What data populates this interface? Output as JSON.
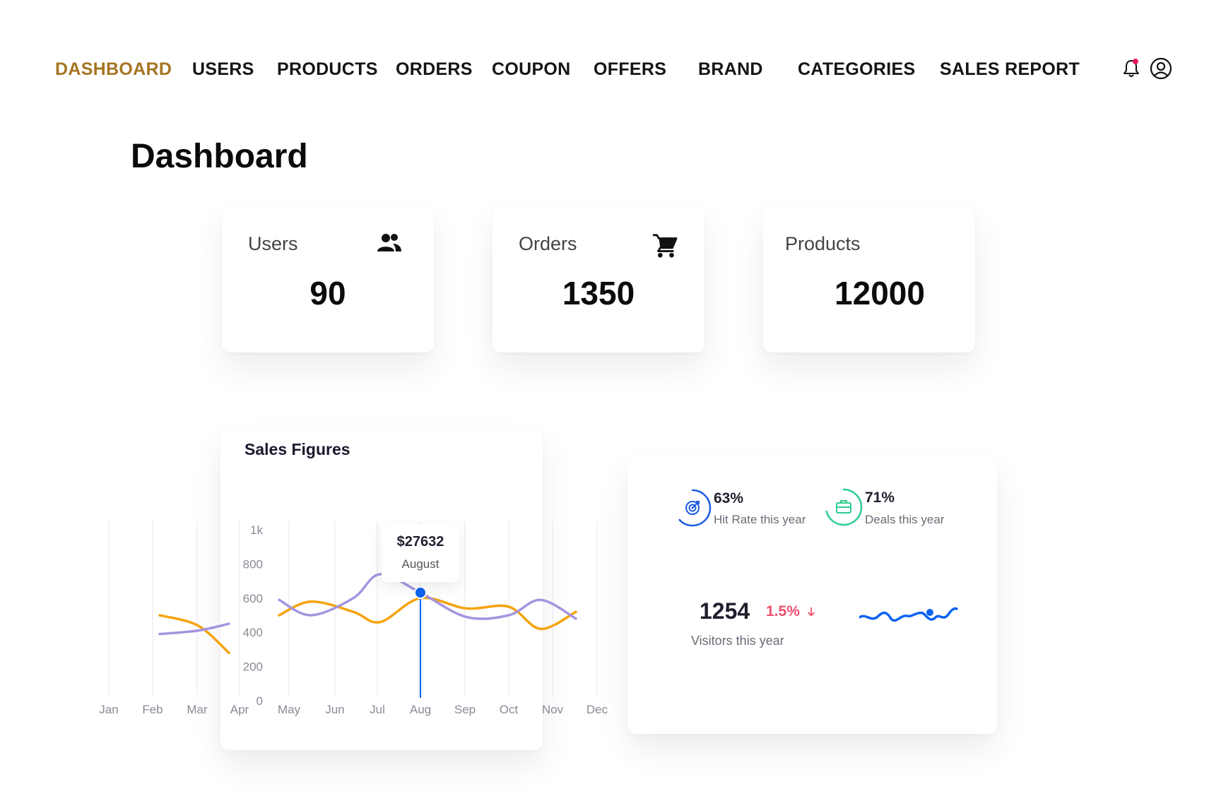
{
  "nav": {
    "items": [
      "DASHBOARD",
      "USERS",
      "PRODUCTS",
      "ORDERS",
      "COUPON",
      "OFFERS",
      "BRAND",
      "CATEGORIES",
      "SALES REPORT"
    ],
    "active": "DASHBOARD",
    "active_color": "#A67422",
    "icons": [
      "bell-icon",
      "user-account-icon"
    ],
    "notification_dot_color": "#E8175D"
  },
  "page": {
    "title": "Dashboard"
  },
  "stats": {
    "users": {
      "label": "Users",
      "value": "90",
      "icon": "users-icon"
    },
    "orders": {
      "label": "Orders",
      "value": "1350",
      "icon": "cart-icon"
    },
    "products": {
      "label": "Products",
      "value": "12000"
    }
  },
  "sales": {
    "title": "Sales Figures",
    "tooltip": {
      "value": "$27632",
      "month": "August"
    }
  },
  "chart_data": {
    "type": "line",
    "title": "Sales Figures",
    "categories": [
      "Jan",
      "Feb",
      "Mar",
      "Apr",
      "May",
      "Jun",
      "Jul",
      "Aug",
      "Sep",
      "Oct",
      "Nov",
      "Dec"
    ],
    "y_ticks": [
      "1k",
      "800",
      "600",
      "400",
      "200",
      "0"
    ],
    "ylim": [
      0,
      1000
    ],
    "grid": "vertical",
    "series": [
      {
        "color": "#F5A30D",
        "values": [
          null,
          500,
          440,
          280,
          500,
          580,
          520,
          460,
          600,
          540,
          550,
          420,
          520
        ]
      },
      {
        "color": "#A594E0",
        "values": [
          null,
          390,
          410,
          450,
          590,
          500,
          600,
          740,
          632,
          490,
          500,
          590,
          480
        ]
      }
    ],
    "highlight": {
      "category": "Aug",
      "value": 632,
      "color": "#0D63F3"
    }
  },
  "kpis": {
    "hit_rate": {
      "value": "63%",
      "label": "Hit Rate this year",
      "icon": "target-icon",
      "color": "#1D5BE0",
      "progress": 0.63
    },
    "deals": {
      "value": "71%",
      "label": "Deals this year",
      "icon": "briefcase-icon",
      "color": "#2ECC8F",
      "progress": 0.71
    },
    "visitors": {
      "value": "1254",
      "change": "1.5%",
      "direction": "down",
      "label": "Visitors this year",
      "change_color": "#F0506E",
      "sparkline_color": "#0D63F3"
    }
  }
}
